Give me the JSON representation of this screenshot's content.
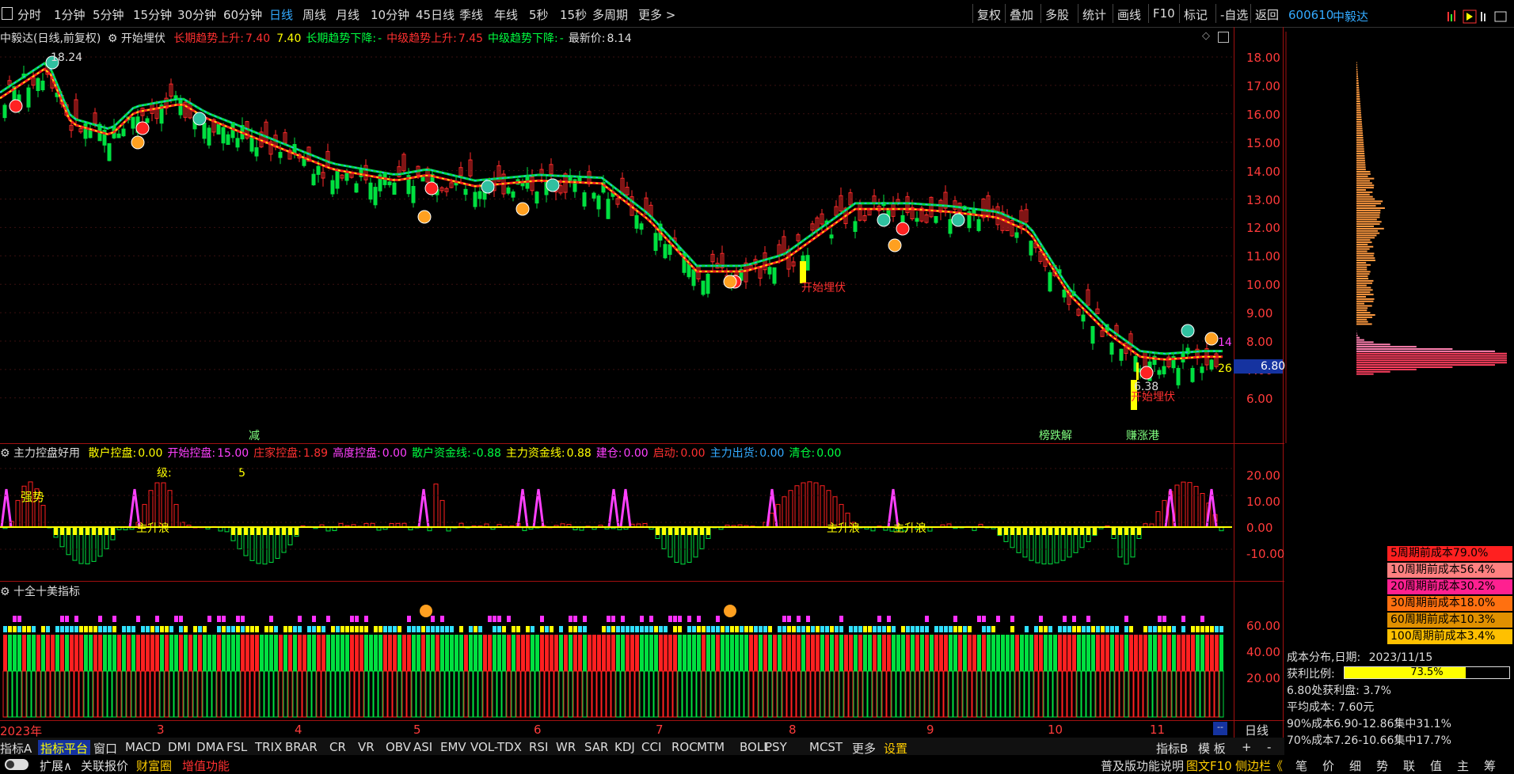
{
  "toolbar": {
    "left_icon": "chart-icon",
    "periods": [
      "分时",
      "1分钟",
      "5分钟",
      "15分钟",
      "30分钟",
      "60分钟",
      "日线",
      "周线",
      "月线",
      "10分钟",
      "45日线",
      "季线",
      "年线",
      "5秒",
      "15秒",
      "多周期",
      "更多 >"
    ],
    "active_period": "日线",
    "right_buttons": [
      "复权",
      "叠加",
      "多股",
      "统计",
      "画线",
      "F10",
      "标记",
      "-自选",
      "返回"
    ],
    "code": "600610",
    "name": "中毅达"
  },
  "main_chart": {
    "title": "中毅达(日线,前复权)",
    "indicator_name": "开始埋伏",
    "legend": [
      {
        "label": "长期趋势上升:",
        "value": "7.40",
        "color": "#ff3030"
      },
      {
        "label": "",
        "value": "7.40",
        "color": "#ffff00"
      },
      {
        "label": "长期趋势下降:",
        "value": "-",
        "color": "#00ff40"
      },
      {
        "label": "中级趋势上升:",
        "value": "7.45",
        "color": "#ff3030"
      },
      {
        "label": "中级趋势下降:",
        "value": "-",
        "color": "#00ff40"
      },
      {
        "label": "最新价:",
        "value": "8.14",
        "color": "#dddddd"
      }
    ],
    "y_ticks": [
      "18.00",
      "17.00",
      "16.00",
      "15.00",
      "14.00",
      "13.00",
      "12.00",
      "11.00",
      "10.00",
      "9.00",
      "8.00",
      "7.00",
      "6.00"
    ],
    "high_label": "18.24",
    "low_label": "6.38",
    "current_price_tag": "6.80",
    "right_marks": [
      "14",
      "26"
    ],
    "annotations": [
      "开始埋伏",
      "开始埋伏"
    ],
    "bottom_badges": [
      "减",
      "榜跌解",
      "赚涨港"
    ]
  },
  "sub1": {
    "name": "主力控盘好用",
    "legend": [
      {
        "label": "散户控盘:",
        "value": "0.00",
        "color": "#ffff00"
      },
      {
        "label": "开始控盘:",
        "value": "15.00",
        "color": "#ff40ff"
      },
      {
        "label": "庄家控盘:",
        "value": "1.89",
        "color": "#ff3030"
      },
      {
        "label": "高度控盘:",
        "value": "0.00",
        "color": "#ff40ff"
      },
      {
        "label": "散户资金线:",
        "value": "-0.88",
        "color": "#00ff40"
      },
      {
        "label": "主力资金线:",
        "value": "0.88",
        "color": "#ffff00"
      },
      {
        "label": "建仓:",
        "value": "0.00",
        "color": "#ff40ff"
      },
      {
        "label": "启动:",
        "value": "0.00",
        "color": "#ff3030"
      },
      {
        "label": "主力出货:",
        "value": "0.00",
        "color": "#3af"
      },
      {
        "label": "清仓:",
        "value": "0.00",
        "color": "#00ff40"
      }
    ],
    "level_label": "级:",
    "level_value": "5",
    "strong_label": "强势",
    "mid_labels": [
      "主升浪",
      "主升浪",
      "主升浪"
    ],
    "y_ticks": [
      "20.00",
      "10.00",
      "0.00",
      "-10.00"
    ]
  },
  "sub2": {
    "name": "十全十美指标",
    "y_ticks": [
      "60.00",
      "40.00",
      "20.00"
    ]
  },
  "x_axis": {
    "labels": [
      "2023年",
      "3",
      "4",
      "5",
      "6",
      "7",
      "8",
      "9",
      "10",
      "11"
    ],
    "period_label": "日线"
  },
  "right_panel": {
    "cost_boxes": [
      {
        "text": "5周期前成本79.0%",
        "color": "#ff2020"
      },
      {
        "text": "10周期前成本56.4%",
        "color": "#ff8080"
      },
      {
        "text": "20周期前成本30.2%",
        "color": "#ff2090"
      },
      {
        "text": "30周期前成本18.0%",
        "color": "#ff7010"
      },
      {
        "text": "60周期前成本10.3%",
        "color": "#e09000"
      },
      {
        "text": "100周期前成本3.4%",
        "color": "#ffc000"
      }
    ],
    "dist_label": "成本分布,日期:",
    "dist_date": "2023/11/15",
    "profit_ratio_label": "获利比例:",
    "profit_ratio": "73.5%",
    "profit_ratio_value": 0.735,
    "line1": "6.80处获利盘: 3.7%",
    "line2": "平均成本: 7.60元",
    "line3": "90%成本6.90-12.86集中31.1%",
    "line4": "70%成本7.26-10.66集中17.7%",
    "bottom_tabs": [
      "笔",
      "价",
      "细",
      "势",
      "联",
      "值",
      "主",
      "筹"
    ]
  },
  "tabs": [
    "指标A",
    "指标平台",
    "窗口",
    "MACD",
    "DMI",
    "DMA",
    "FSL",
    "TRIX",
    "BRAR",
    "CR",
    "VR",
    "OBV",
    "ASI",
    "EMV",
    "VOL-TDX",
    "RSI",
    "WR",
    "SAR",
    "KDJ",
    "CCI",
    "ROC",
    "MTM",
    "BOLL",
    "PSY",
    "MCST",
    "更多",
    "设置"
  ],
  "tabs_right": [
    "指标B",
    "模 板",
    "+",
    "-"
  ],
  "status": {
    "items": [
      {
        "text": "扩展∧",
        "color": "#ddd"
      },
      {
        "text": "关联报价",
        "color": "#ddd"
      },
      {
        "text": "财富圈",
        "color": "#ffcc00"
      },
      {
        "text": "增值功能",
        "color": "#ff3030"
      }
    ],
    "right_items": [
      {
        "text": "普及版功能说明",
        "color": "#ddd"
      },
      {
        "text": "图文F10",
        "color": "#ffcc00"
      },
      {
        "text": "侧边栏《",
        "color": "#ffcc00"
      }
    ]
  }
}
